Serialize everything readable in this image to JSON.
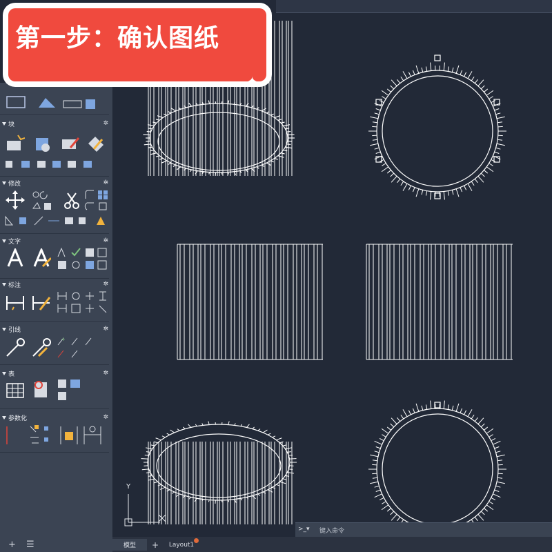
{
  "banner": {
    "title": "第一步：确认图纸"
  },
  "palette": {
    "sections": [
      {
        "label": "块"
      },
      {
        "label": "修改"
      },
      {
        "label": "文字"
      },
      {
        "label": "标注"
      },
      {
        "label": "引线"
      },
      {
        "label": "表"
      },
      {
        "label": "参数化"
      }
    ],
    "bottom": {
      "add_symbol": "+",
      "menu_symbol": "☰"
    }
  },
  "status_bar": {
    "tabs": [
      {
        "label": "模型",
        "active": true
      },
      {
        "label": "+",
        "active": false
      },
      {
        "label": "Layout1",
        "active": false
      }
    ]
  },
  "command_line": {
    "prompt": ">_▾",
    "placeholder": "键入命令"
  },
  "ucs": {
    "y_label": "Y"
  },
  "colors": {
    "canvas": "#222937",
    "banner": "#f04a3e",
    "palette": "#3b4453",
    "accent_dot": "#e06a3a"
  }
}
